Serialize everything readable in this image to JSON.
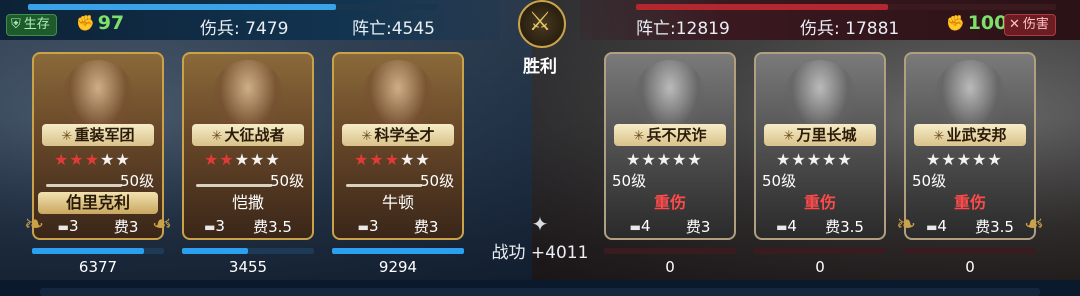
{
  "left_side": {
    "status_badge": "生存",
    "morale": "97",
    "wounded": "伤兵: 7479",
    "dead": "阵亡:4545",
    "hp_fraction": 0.75
  },
  "right_side": {
    "status_badge": "伤害",
    "morale": "100",
    "wounded": "伤兵: 17881",
    "dead": "阵亡:12819",
    "hp_fraction": 0.6
  },
  "center": {
    "result": "胜利",
    "merit": "战功 +4011"
  },
  "cards": [
    {
      "skill": "重装军团",
      "stars": 3,
      "level": "50级",
      "name": "伯里克利",
      "unit_count": "3",
      "cost": "费3",
      "hp_fraction": 0.85,
      "score": "6377",
      "side": "left",
      "injured": false,
      "plaque": true
    },
    {
      "skill": "大征战者",
      "stars": 2,
      "level": "50级",
      "name": "恺撒",
      "unit_count": "3",
      "cost": "费3.5",
      "hp_fraction": 0.5,
      "score": "3455",
      "side": "left",
      "injured": false,
      "plaque": false
    },
    {
      "skill": "科学全才",
      "stars": 3,
      "level": "50级",
      "name": "牛顿",
      "unit_count": "3",
      "cost": "费3",
      "hp_fraction": 1.0,
      "score": "9294",
      "side": "left",
      "injured": false,
      "plaque": false
    },
    {
      "skill": "兵不厌诈",
      "stars": 0,
      "level": "50级",
      "name": "重伤",
      "unit_count": "4",
      "cost": "费3",
      "hp_fraction": 0.0,
      "score": "0",
      "side": "right",
      "injured": true,
      "plaque": false
    },
    {
      "skill": "万里长城",
      "stars": 0,
      "level": "50级",
      "name": "重伤",
      "unit_count": "4",
      "cost": "费3.5",
      "hp_fraction": 0.0,
      "score": "0",
      "side": "right",
      "injured": true,
      "plaque": false
    },
    {
      "skill": "业武安邦",
      "stars": 0,
      "level": "50级",
      "name": "重伤",
      "unit_count": "4",
      "cost": "费3.5",
      "hp_fraction": 0.0,
      "score": "0",
      "side": "right",
      "injured": true,
      "plaque": false
    }
  ],
  "icons": {
    "shield": "shield-icon",
    "fist": "fist-icon",
    "close": "close-icon",
    "sword_emblem": "sword-emblem-icon",
    "merit": "merit-icon",
    "tank": "tank-icon"
  },
  "colors": {
    "ally_accent": "#3aa3e8",
    "enemy_accent": "#b4272e",
    "injured_text": "#ff4a4a",
    "morale_green": "#7ee06a"
  }
}
